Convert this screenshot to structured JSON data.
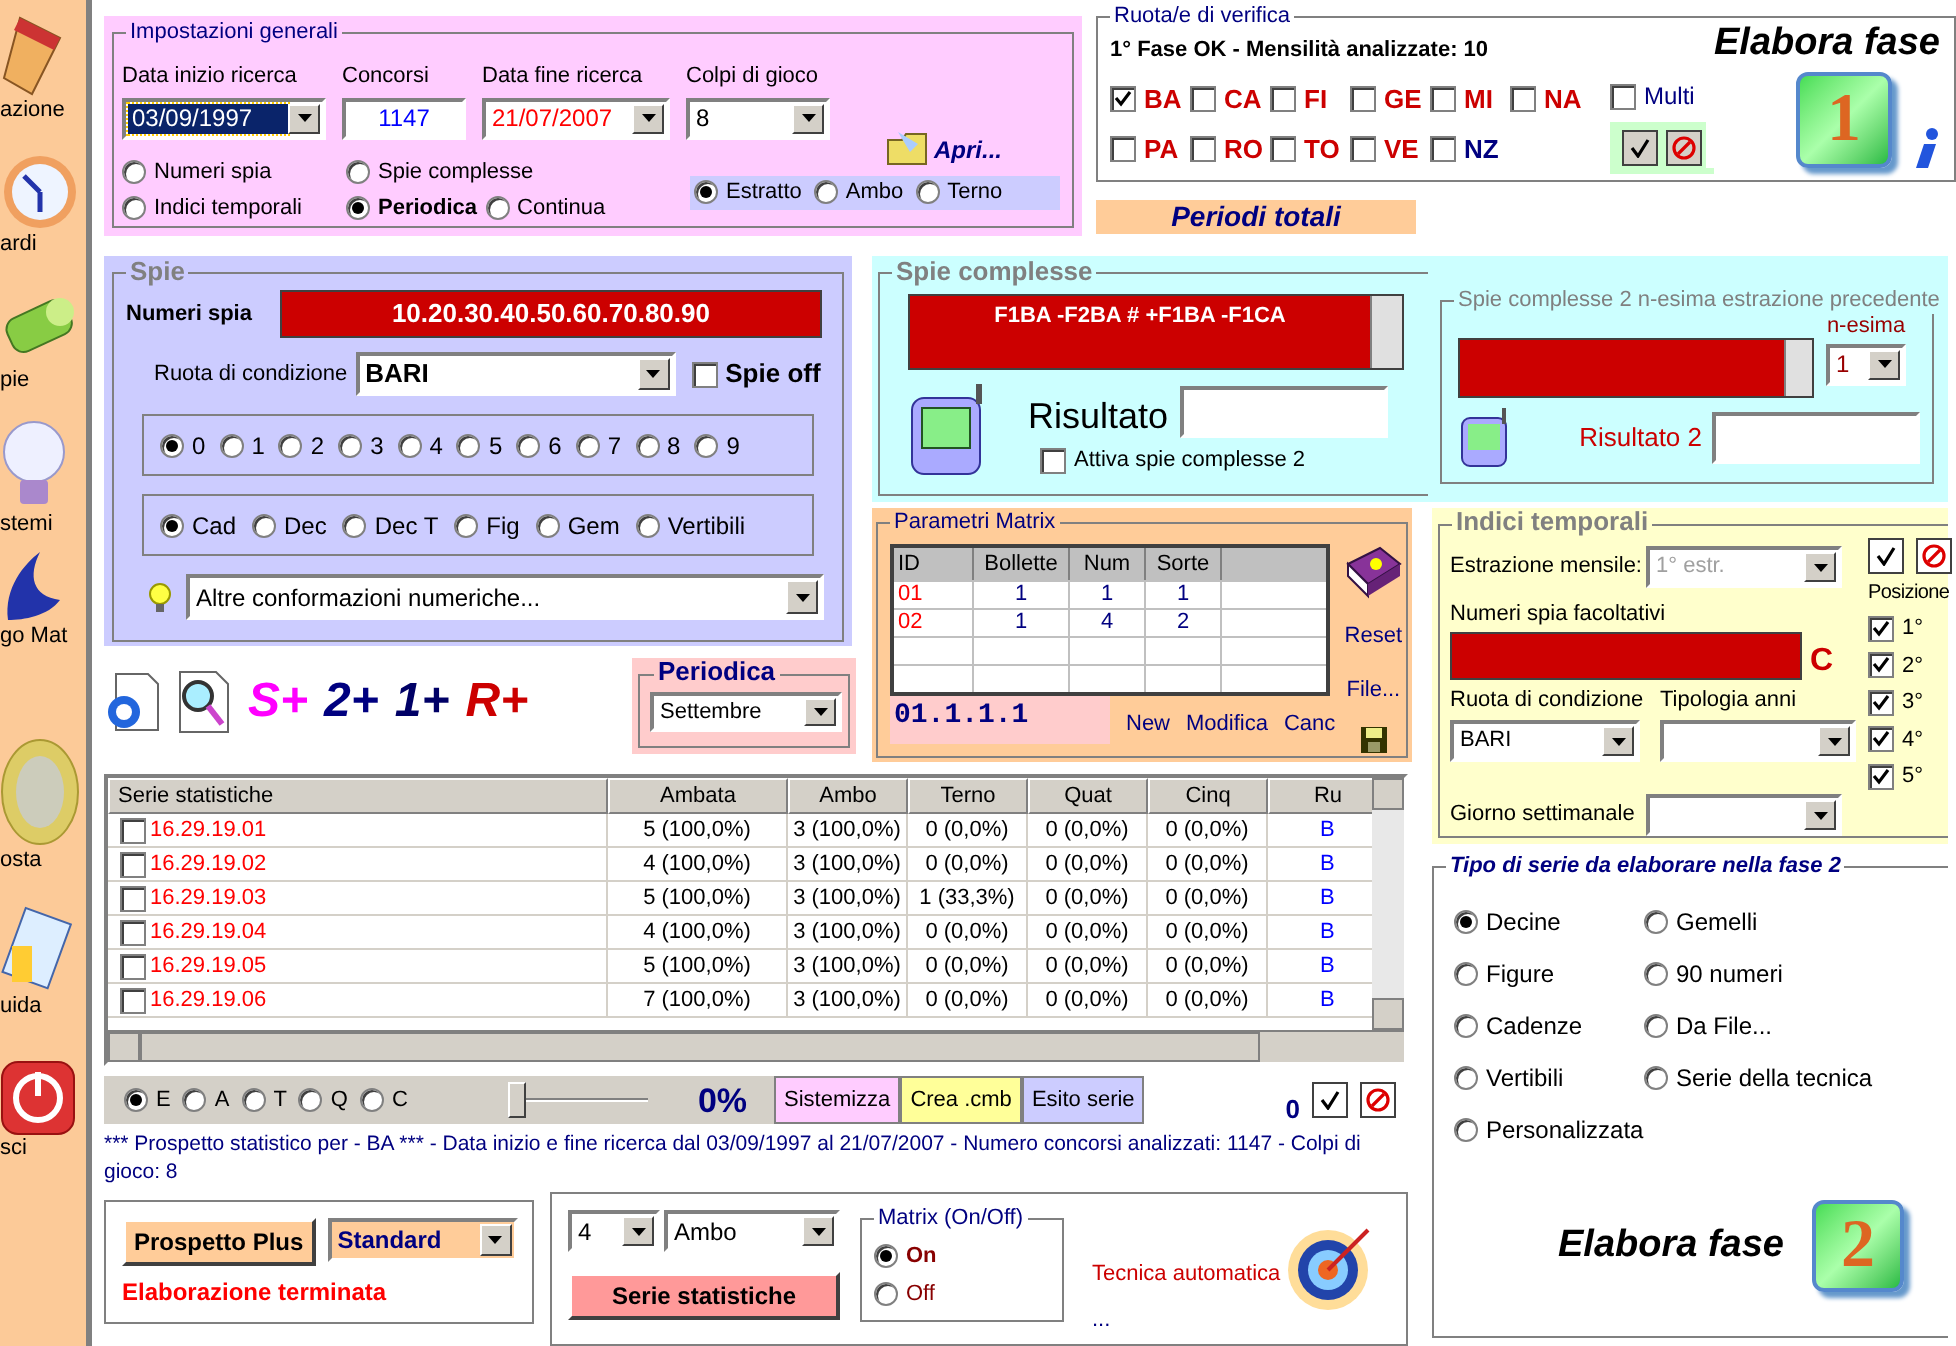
{
  "sidebar": {
    "items": [
      {
        "label": "azione"
      },
      {
        "label": "ardi"
      },
      {
        "label": "pie"
      },
      {
        "label": "stemi"
      },
      {
        "label": "go Mat"
      },
      {
        "label": "osta"
      },
      {
        "label": "uida"
      },
      {
        "label": "sci"
      }
    ]
  },
  "general_settings": {
    "title": "Impostazioni generali",
    "fields": [
      {
        "label": "Data inizio ricerca",
        "value": "03/09/1997",
        "kind": "dropdown",
        "focused": true
      },
      {
        "label": "Concorsi",
        "value": "1147",
        "kind": "text",
        "focused": false
      },
      {
        "label": "Data fine ricerca",
        "value": "21/07/2007",
        "kind": "dropdown",
        "focused": false
      },
      {
        "label": "Colpi di gioco",
        "value": "8",
        "kind": "dropdown",
        "focused": false
      }
    ],
    "modes": [
      {
        "label": "Numeri spia",
        "selected": false
      },
      {
        "label": "Spie complesse",
        "selected": false
      },
      {
        "label": "Indici temporali",
        "selected": false
      },
      {
        "label": "Periodica",
        "selected": true
      },
      {
        "label": "Continua",
        "selected": false
      }
    ],
    "open_button": "Apri...",
    "outcome": [
      {
        "label": "Estratto",
        "selected": true
      },
      {
        "label": "Ambo",
        "selected": false
      },
      {
        "label": "Terno",
        "selected": false
      }
    ]
  },
  "verification": {
    "title": "Ruota/e di verifica",
    "status": "1° Fase OK - Mensilità analizzate: 10",
    "wheels": [
      {
        "label": "BA",
        "checked": true,
        "color": "#cc0000"
      },
      {
        "label": "CA",
        "checked": false,
        "color": "#cc0000"
      },
      {
        "label": "FI",
        "checked": false,
        "color": "#cc0000"
      },
      {
        "label": "GE",
        "checked": false,
        "color": "#cc0000"
      },
      {
        "label": "MI",
        "checked": false,
        "color": "#cc0000"
      },
      {
        "label": "NA",
        "checked": false,
        "color": "#cc0000"
      },
      {
        "label": "PA",
        "checked": false,
        "color": "#cc0000"
      },
      {
        "label": "RO",
        "checked": false,
        "color": "#cc0000"
      },
      {
        "label": "TO",
        "checked": false,
        "color": "#cc0000"
      },
      {
        "label": "VE",
        "checked": false,
        "color": "#cc0000"
      },
      {
        "label": "NZ",
        "checked": false,
        "color": "#000080"
      }
    ],
    "multi": {
      "label": "Multi",
      "checked": false
    }
  },
  "phase1": {
    "label": "Elabora fase",
    "badge": "1"
  },
  "periodi_totali": "Periodi totali",
  "spie": {
    "title": "Spie",
    "numbers_label": "Numeri spia",
    "numbers": "10.20.30.40.50.60.70.80.90",
    "wheel_label": "Ruota di condizione",
    "wheel": "BARI",
    "spie_off": {
      "label": "Spie off",
      "checked": false
    },
    "digits": [
      {
        "label": "0",
        "selected": true
      },
      {
        "label": "1",
        "selected": false
      },
      {
        "label": "2",
        "selected": false
      },
      {
        "label": "3",
        "selected": false
      },
      {
        "label": "4",
        "selected": false
      },
      {
        "label": "5",
        "selected": false
      },
      {
        "label": "6",
        "selected": false
      },
      {
        "label": "7",
        "selected": false
      },
      {
        "label": "8",
        "selected": false
      },
      {
        "label": "9",
        "selected": false
      }
    ],
    "groups": [
      {
        "label": "Cad",
        "selected": true
      },
      {
        "label": "Dec",
        "selected": false
      },
      {
        "label": "Dec T",
        "selected": false
      },
      {
        "label": "Fig",
        "selected": false
      },
      {
        "label": "Gem",
        "selected": false
      },
      {
        "label": "Vertibili",
        "selected": false
      }
    ],
    "conformations": "Altre conformazioni numeriche..."
  },
  "tools": [
    {
      "label": "S+",
      "color": "#ff00ff"
    },
    {
      "label": "2+",
      "color": "#000080"
    },
    {
      "label": "1+",
      "color": "#000066"
    },
    {
      "label": "R+",
      "color": "#cc0000"
    }
  ],
  "periodica": {
    "title": "Periodica",
    "value": "Settembre"
  },
  "spie_complesse": {
    "title": "Spie complesse",
    "formula": "F1BA -F2BA # +F1BA -F1CA",
    "result_label": "Risultato",
    "activate": {
      "label": "Attiva spie complesse 2",
      "checked": false
    },
    "second": {
      "title": "Spie complesse 2 n-esima estrazione precedente",
      "nth_label": "n-esima",
      "nth": "1",
      "result_label": "Risultato 2"
    }
  },
  "matrix": {
    "title": "Parametri Matrix",
    "columns": [
      "ID",
      "Bollette",
      "Num",
      "Sorte"
    ],
    "rows": [
      [
        "01",
        "1",
        "1",
        "1"
      ],
      [
        "02",
        "1",
        "4",
        "2"
      ]
    ],
    "code": "01.1.1.1",
    "links": [
      "New",
      "Modifica",
      "Canc"
    ],
    "side_links": [
      "Reset",
      "File..."
    ]
  },
  "indici": {
    "title": "Indici temporali",
    "monthly_label": "Estrazione mensile:",
    "monthly": "1° estr.",
    "optional_label": "Numeri spia facoltativi",
    "clear": "C",
    "wheel_label": "Ruota di condizione",
    "wheel": "BARI",
    "years_label": "Tipologia anni",
    "weekday_label": "Giorno settimanale",
    "positions_label": "Posizione",
    "positions": [
      {
        "label": "1°",
        "checked": true
      },
      {
        "label": "2°",
        "checked": true
      },
      {
        "label": "3°",
        "checked": true
      },
      {
        "label": "4°",
        "checked": true
      },
      {
        "label": "5°",
        "checked": true
      }
    ]
  },
  "table": {
    "columns": [
      "Serie statistiche",
      "Ambata",
      "Ambo",
      "Terno",
      "Quat",
      "Cinq",
      "Ru"
    ],
    "rows": [
      {
        "checked": false,
        "cells": [
          "16.29.19.01",
          "5 (100,0%)",
          "3 (100,0%)",
          "0 (0,0%)",
          "0 (0,0%)",
          "0 (0,0%)",
          "B"
        ]
      },
      {
        "checked": false,
        "cells": [
          "16.29.19.02",
          "4 (100,0%)",
          "3 (100,0%)",
          "0 (0,0%)",
          "0 (0,0%)",
          "0 (0,0%)",
          "B"
        ]
      },
      {
        "checked": false,
        "cells": [
          "16.29.19.03",
          "5 (100,0%)",
          "3 (100,0%)",
          "1 (33,3%)",
          "0 (0,0%)",
          "0 (0,0%)",
          "B"
        ]
      },
      {
        "checked": false,
        "cells": [
          "16.29.19.04",
          "4 (100,0%)",
          "3 (100,0%)",
          "0 (0,0%)",
          "0 (0,0%)",
          "0 (0,0%)",
          "B"
        ]
      },
      {
        "checked": false,
        "cells": [
          "16.29.19.05",
          "5 (100,0%)",
          "3 (100,0%)",
          "0 (0,0%)",
          "0 (0,0%)",
          "0 (0,0%)",
          "B"
        ]
      },
      {
        "checked": false,
        "cells": [
          "16.29.19.06",
          "7 (100,0%)",
          "3 (100,0%)",
          "0 (0,0%)",
          "0 (0,0%)",
          "0 (0,0%)",
          "B"
        ]
      }
    ]
  },
  "controls": {
    "outcome": [
      {
        "label": "E",
        "selected": true
      },
      {
        "label": "A",
        "selected": false
      },
      {
        "label": "T",
        "selected": false
      },
      {
        "label": "Q",
        "selected": false
      },
      {
        "label": "C",
        "selected": false
      }
    ],
    "slider": {
      "level": 0
    },
    "percent": "0%",
    "buttons": [
      {
        "label": "Sistemizza",
        "color": "#ffccff"
      },
      {
        "label": "Crea .cmb",
        "color": "#ffff99"
      },
      {
        "label": "Esito serie",
        "color": "#ccccff"
      }
    ],
    "count": "0"
  },
  "summary": "*** Prospetto statistico per  - BA ***  - Data inizio e fine ricerca dal 03/09/1997 al 21/07/2007 - Numero concorsi analizzati: 1147 - Colpi di gioco: 8",
  "prospetto": {
    "button": "Prospetto Plus",
    "mode": "Standard",
    "status": "Elaborazione terminata"
  },
  "serie": {
    "size": "4",
    "sort": "Ambo",
    "button": "Serie statistiche",
    "matrix_title": "Matrix (On/Off)",
    "matrix": [
      {
        "label": "On",
        "selected": true
      },
      {
        "label": "Off",
        "selected": false
      }
    ],
    "technique": "Tecnica automatica",
    "more": "..."
  },
  "phase2": {
    "title": "Tipo di serie da elaborare nella fase 2",
    "options": [
      {
        "label": "Decine",
        "selected": true
      },
      {
        "label": "Gemelli",
        "selected": false
      },
      {
        "label": "Figure",
        "selected": false
      },
      {
        "label": "90 numeri",
        "selected": false
      },
      {
        "label": "Cadenze",
        "selected": false
      },
      {
        "label": "Da File...",
        "selected": false
      },
      {
        "label": "Vertibili",
        "selected": false
      },
      {
        "label": "Serie della tecnica",
        "selected": false
      },
      {
        "label": "Personalizzata",
        "selected": false
      }
    ],
    "label": "Elabora fase",
    "badge": "2"
  }
}
